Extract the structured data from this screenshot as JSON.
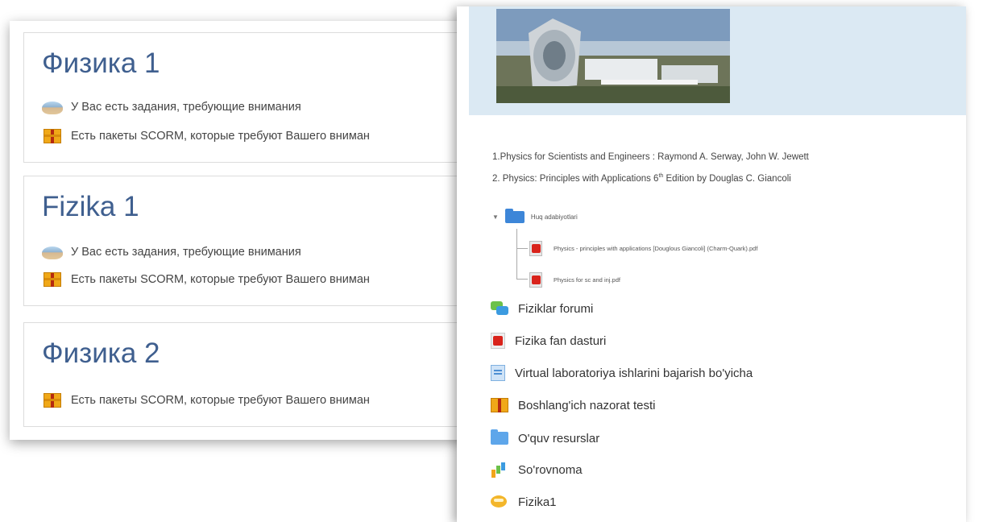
{
  "courses": [
    {
      "title": "Физика 1",
      "notices": [
        {
          "icon": "assignment-icon",
          "text": "У Вас есть задания, требующие внимания"
        },
        {
          "icon": "scorm-package-icon",
          "text": "Есть пакеты SCORM, которые требуют Вашего вниман"
        }
      ]
    },
    {
      "title": "Fizika 1",
      "notices": [
        {
          "icon": "assignment-icon",
          "text": "У Вас есть задания, требующие внимания"
        },
        {
          "icon": "scorm-package-icon",
          "text": "Есть пакеты SCORM, которые требуют Вашего вниман"
        }
      ]
    },
    {
      "title": "Физика 2",
      "notices": [
        {
          "icon": "scorm-package-icon",
          "text": "Есть пакеты SCORM, которые требуют Вашего вниман"
        }
      ]
    }
  ],
  "course_page": {
    "books": [
      {
        "text_before": "1.Physics  for Scientists and Engineers : Raymond A. Serway, John W. Jewett",
        "sup": "",
        "text_after": ""
      },
      {
        "text_before": "2. Physics: Principles with Applications 6",
        "sup": "th",
        "text_after": " Edition by Douglas C. Giancoli"
      }
    ],
    "folder": {
      "name": "Huq adabiyotlari",
      "icon": "folder-icon",
      "files": [
        {
          "name": "Physics - principles with applications [Douglous Giancoli] (Charm-Quark).pdf",
          "icon": "pdf-icon"
        },
        {
          "name": "Physics for sc and inj.pdf",
          "icon": "pdf-icon"
        }
      ]
    },
    "activities": [
      {
        "label": "Fiziklar forumi",
        "icon": "forum-icon"
      },
      {
        "label": "Fizika fan dasturi",
        "icon": "pdf-icon"
      },
      {
        "label": "Virtual laboratoriya ishlarini bajarish bo'yicha",
        "icon": "page-icon"
      },
      {
        "label": "Boshlang'ich nazorat testi",
        "icon": "scorm-package-icon"
      },
      {
        "label": "O'quv resurslar",
        "icon": "folder-icon"
      },
      {
        "label": "So'rovnoma",
        "icon": "feedback-chart-icon"
      },
      {
        "label": "Fizika1",
        "icon": "chat-icon"
      }
    ]
  }
}
